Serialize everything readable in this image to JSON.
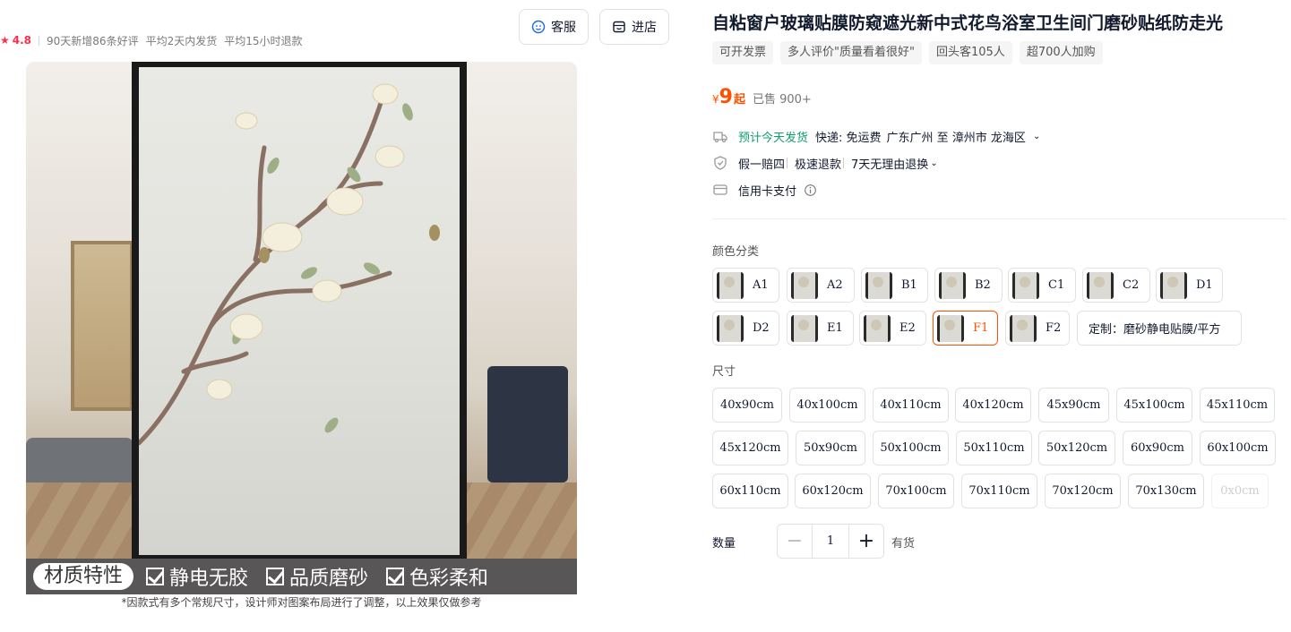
{
  "rating": {
    "score": "4.8",
    "stats": [
      "90天新增86条好评",
      "平均2天内发货",
      "平均15小时退款"
    ]
  },
  "header_buttons": {
    "service": "客服",
    "store": "进店"
  },
  "gallery": {
    "badge": "材质特性",
    "features": [
      "静电无胶",
      "品质磨砂",
      "色彩柔和"
    ],
    "note": "*因款式有多个常规尺寸，设计师对图案布局进行了调整，以上效果仅做参考"
  },
  "product": {
    "title": "自粘窗户玻璃贴膜防窥遮光新中式花鸟浴室卫生间门磨砂贴纸防走光",
    "tags": [
      "可开发票",
      "多人评价\"质量看着很好\"",
      "回头客105人",
      "超700人加购"
    ],
    "price": {
      "currency": "¥",
      "value": "9",
      "suffix": "起",
      "sold": "已售 900+"
    }
  },
  "delivery": {
    "eta": "预计今天发货",
    "shipping": "快递: 免运费",
    "route": "广东广州 至 漳州市 龙海区"
  },
  "guarantee": {
    "items": [
      "假一赔四",
      "极速退款",
      "7天无理由退换"
    ]
  },
  "payment": {
    "label": "信用卡支付"
  },
  "colors": {
    "label": "颜色分类",
    "options": [
      "A1",
      "A2",
      "B1",
      "B2",
      "C1",
      "C2",
      "D1",
      "D2",
      "E1",
      "E2",
      "F1",
      "F2",
      "定制：磨砂静电贴膜/平方"
    ],
    "selected": "F1"
  },
  "sizes": {
    "label": "尺寸",
    "options": [
      "40x90cm",
      "40x100cm",
      "40x110cm",
      "40x120cm",
      "45x90cm",
      "45x100cm",
      "45x110cm",
      "45x120cm",
      "50x90cm",
      "50x100cm",
      "50x110cm",
      "50x120cm",
      "60x90cm",
      "60x100cm",
      "60x110cm",
      "60x120cm",
      "70x100cm",
      "70x110cm",
      "70x120cm",
      "70x130cm",
      "0x0cm"
    ]
  },
  "quantity": {
    "label": "数量",
    "value": "1",
    "stock": "有货"
  },
  "colors_theme": {
    "accent": "#ff5000",
    "green": "#0f9e6e",
    "star": "#ff2c4a"
  }
}
